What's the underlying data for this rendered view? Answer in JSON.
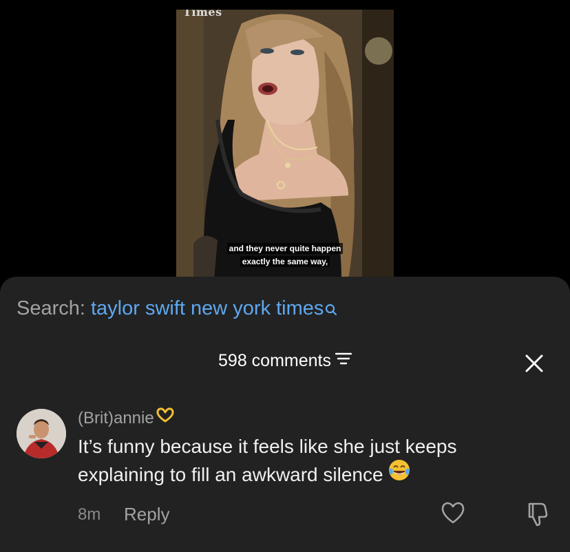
{
  "video": {
    "watermark": "Times",
    "caption_line1": "and they never quite happen",
    "caption_line2": "exactly the same way,"
  },
  "search": {
    "prefix": "Search: ",
    "query": "taylor swift new york times",
    "icon": "search-icon"
  },
  "comments_header": {
    "count_label": "598 comments",
    "filter_icon": "filter-icon",
    "close_icon": "close-icon"
  },
  "comment": {
    "username": "(Brit)annie",
    "username_emoji": "heart-hands-icon",
    "text": "It’s funny because it feels like she just keeps explaining to fill an awkward silence",
    "text_emoji": "face-with-tears-of-joy-icon",
    "timestamp": "8m",
    "reply_label": "Reply",
    "like_icon": "heart-outline-icon",
    "dislike_icon": "thumbs-down-icon"
  },
  "colors": {
    "sheet_bg": "#222222",
    "search_query": "#5ea8f0",
    "muted_text": "#a3a3a3",
    "primary_text": "#f0f0f0",
    "emoji_yellow": "#f5c032"
  }
}
